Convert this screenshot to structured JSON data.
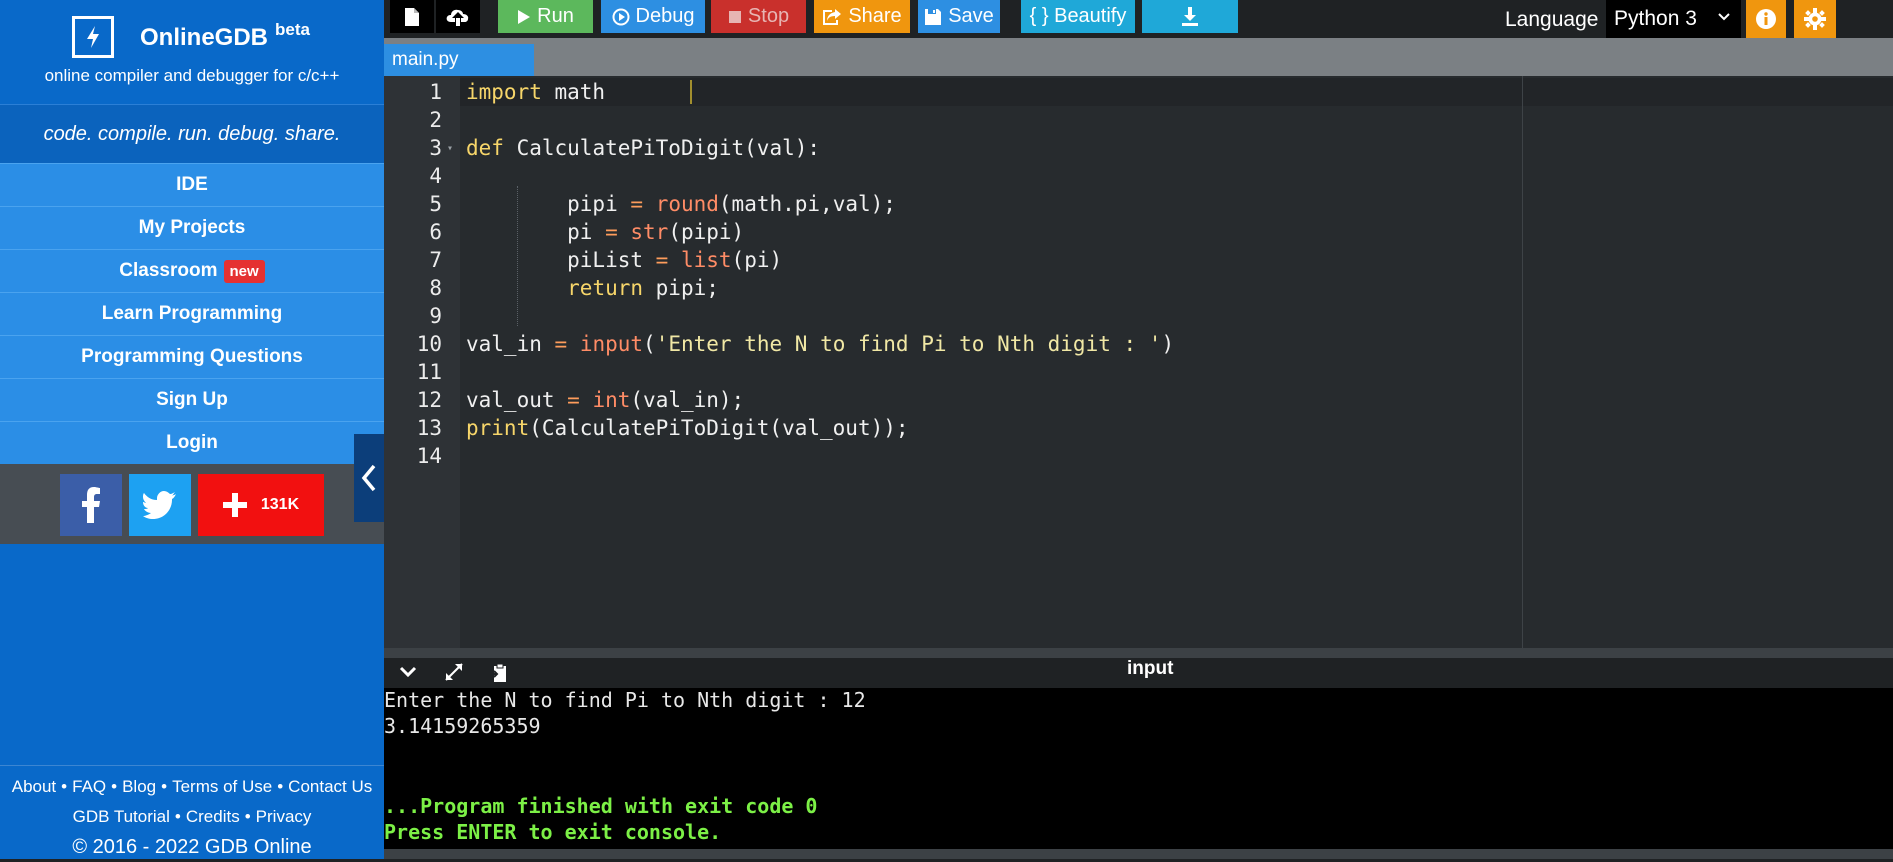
{
  "brand": {
    "name": "OnlineGDB",
    "beta": "beta",
    "tagline": "online compiler and debugger for c/c++",
    "motto": "code. compile. run. debug. share."
  },
  "nav": {
    "items": [
      {
        "label": "IDE"
      },
      {
        "label": "My Projects"
      },
      {
        "label": "Classroom",
        "badge": "new"
      },
      {
        "label": "Learn Programming"
      },
      {
        "label": "Programming Questions"
      },
      {
        "label": "Sign Up"
      },
      {
        "label": "Login"
      }
    ]
  },
  "social": {
    "share_count": "131K"
  },
  "footer": {
    "links": [
      "About",
      "FAQ",
      "Blog",
      "Terms of Use",
      "Contact Us",
      "GDB Tutorial",
      "Credits",
      "Privacy"
    ],
    "copyright": "© 2016 - 2022 GDB Online"
  },
  "toolbar": {
    "run": "Run",
    "debug": "Debug",
    "stop": "Stop",
    "share": "Share",
    "save": "Save",
    "beautify": "{ } Beautify",
    "language_label": "Language",
    "language_value": "Python 3"
  },
  "tabs": [
    {
      "label": "main.py"
    }
  ],
  "editor": {
    "lines": [
      "1",
      "2",
      "3",
      "4",
      "5",
      "6",
      "7",
      "8",
      "9",
      "10",
      "11",
      "12",
      "13",
      "14"
    ]
  },
  "console": {
    "title": "input",
    "lines": [
      "Enter the N to find Pi to Nth digit : 12",
      "3.14159265359",
      "",
      "",
      "...Program finished with exit code 0",
      "Press ENTER to exit console."
    ]
  },
  "colors": {
    "sidebar": "#0969c9",
    "nav_item": "#2b8ee6",
    "run": "#5cb85c",
    "debug": "#2d8fe2",
    "stop": "#c9302c",
    "share": "#f0960e",
    "save": "#2d8fe2",
    "beautify": "#1fa8d8",
    "download": "#1fa8d8",
    "settings": "#f0960e",
    "console_green": "#7cf046"
  }
}
